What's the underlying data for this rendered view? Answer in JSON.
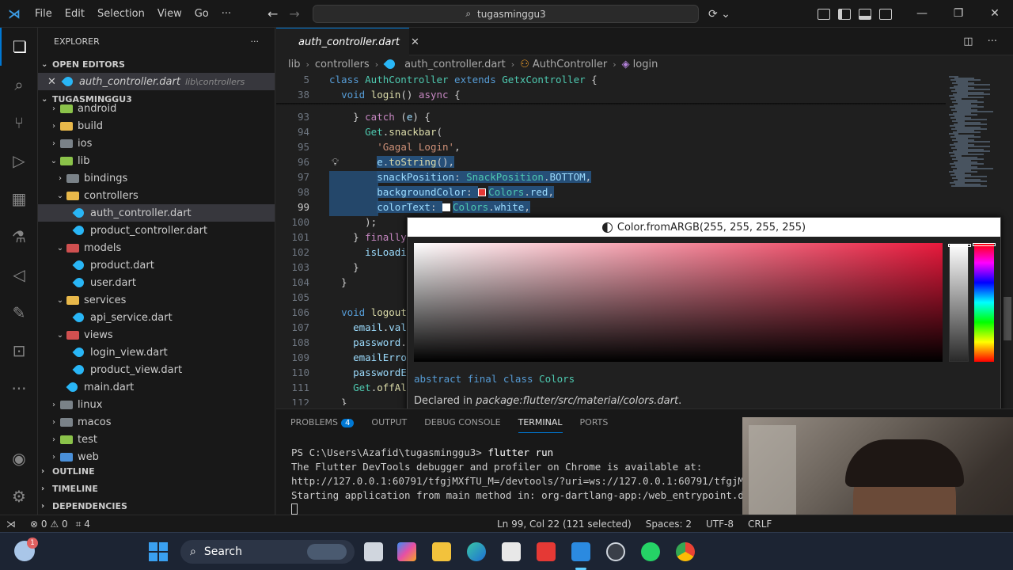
{
  "titlebar": {
    "menu": [
      "File",
      "Edit",
      "Selection",
      "View",
      "Go"
    ],
    "more": "···",
    "search": "tugasminggu3"
  },
  "sidebar": {
    "title": "EXPLORER",
    "more": "···",
    "open_editors_label": "OPEN EDITORS",
    "open_editor": {
      "name": "auth_controller.dart",
      "path": "lib\\controllers"
    },
    "project_label": "TUGASMINGGU3",
    "tree": [
      {
        "label": "android",
        "depth": 1,
        "type": "folder",
        "color": "green",
        "twisty": "›"
      },
      {
        "label": "build",
        "depth": 1,
        "type": "folder",
        "color": "yellow",
        "twisty": "›"
      },
      {
        "label": "ios",
        "depth": 1,
        "type": "folder",
        "color": "grey",
        "twisty": "›"
      },
      {
        "label": "lib",
        "depth": 1,
        "type": "folder",
        "color": "green",
        "twisty": "⌄"
      },
      {
        "label": "bindings",
        "depth": 2,
        "type": "folder",
        "color": "grey",
        "twisty": "›"
      },
      {
        "label": "controllers",
        "depth": 2,
        "type": "folder",
        "color": "yellow",
        "twisty": "⌄"
      },
      {
        "label": "auth_controller.dart",
        "depth": 3,
        "type": "dart",
        "selected": true
      },
      {
        "label": "product_controller.dart",
        "depth": 3,
        "type": "dart"
      },
      {
        "label": "models",
        "depth": 2,
        "type": "folder",
        "color": "red",
        "twisty": "⌄"
      },
      {
        "label": "product.dart",
        "depth": 3,
        "type": "dart"
      },
      {
        "label": "user.dart",
        "depth": 3,
        "type": "dart"
      },
      {
        "label": "services",
        "depth": 2,
        "type": "folder",
        "color": "yellow",
        "twisty": "⌄"
      },
      {
        "label": "api_service.dart",
        "depth": 3,
        "type": "dart"
      },
      {
        "label": "views",
        "depth": 2,
        "type": "folder",
        "color": "red",
        "twisty": "⌄"
      },
      {
        "label": "login_view.dart",
        "depth": 3,
        "type": "dart"
      },
      {
        "label": "product_view.dart",
        "depth": 3,
        "type": "dart"
      },
      {
        "label": "main.dart",
        "depth": 2,
        "type": "dart"
      },
      {
        "label": "linux",
        "depth": 1,
        "type": "folder",
        "color": "grey",
        "twisty": "›"
      },
      {
        "label": "macos",
        "depth": 1,
        "type": "folder",
        "color": "grey",
        "twisty": "›"
      },
      {
        "label": "test",
        "depth": 1,
        "type": "folder",
        "color": "green",
        "twisty": "›"
      },
      {
        "label": "web",
        "depth": 1,
        "type": "folder",
        "color": "blue",
        "twisty": "›"
      }
    ],
    "bottom_sections": [
      "OUTLINE",
      "TIMELINE",
      "DEPENDENCIES"
    ]
  },
  "editor": {
    "tab": "auth_controller.dart",
    "breadcrumb": [
      "lib",
      "controllers",
      "auth_controller.dart",
      "AuthController",
      "login"
    ]
  },
  "code": [
    {
      "n": "5",
      "sticky": true,
      "tokens": [
        [
          "kw",
          "class "
        ],
        [
          "ty",
          "AuthController "
        ],
        [
          "kw",
          "extends "
        ],
        [
          "ty",
          "GetxController "
        ],
        [
          "",
          "{"
        ]
      ]
    },
    {
      "n": "38",
      "sticky": true,
      "tokens": [
        [
          "",
          "  "
        ],
        [
          "kw",
          "void "
        ],
        [
          "fn",
          "login"
        ],
        [
          "",
          "() "
        ],
        [
          "kw2",
          "async "
        ],
        [
          "",
          "{"
        ]
      ]
    },
    {
      "n": "93",
      "tokens": [
        [
          "",
          "    } "
        ],
        [
          "kw2",
          "catch "
        ],
        [
          "",
          "("
        ],
        [
          "pm",
          "e"
        ],
        [
          "",
          ") {"
        ]
      ]
    },
    {
      "n": "94",
      "tokens": [
        [
          "",
          "      "
        ],
        [
          "ty",
          "Get"
        ],
        [
          "",
          "."
        ],
        [
          "fn",
          "snackbar"
        ],
        [
          "",
          "("
        ]
      ]
    },
    {
      "n": "95",
      "tokens": [
        [
          "",
          "        "
        ],
        [
          "st",
          "'Gagal Login'"
        ],
        [
          "",
          ","
        ]
      ]
    },
    {
      "n": "96",
      "tokens": [
        [
          "",
          "        "
        ],
        [
          "pm",
          "e"
        ],
        [
          "",
          "."
        ],
        [
          "fn",
          "toString"
        ],
        [
          "",
          "(),"
        ]
      ],
      "sel": "partial"
    },
    {
      "n": "97",
      "tokens": [
        [
          "",
          "        "
        ],
        [
          "pm",
          "snackPosition"
        ],
        [
          "",
          ": "
        ],
        [
          "ty",
          "SnackPosition"
        ],
        [
          "",
          "."
        ],
        [
          "pm",
          "BOTTOM"
        ],
        [
          "",
          ","
        ]
      ],
      "sel": "full"
    },
    {
      "n": "98",
      "tokens": [
        [
          "",
          "        "
        ],
        [
          "pm",
          "backgroundColor"
        ],
        [
          "",
          ": "
        ],
        [
          "swatch",
          "#e53935"
        ],
        [
          "ty",
          "Colors"
        ],
        [
          "",
          "."
        ],
        [
          "pm",
          "red"
        ],
        [
          "",
          ","
        ]
      ],
      "sel": "full"
    },
    {
      "n": "99",
      "tokens": [
        [
          "",
          "        "
        ],
        [
          "pm",
          "colorText"
        ],
        [
          "",
          ": "
        ],
        [
          "swatch",
          "#ffffff"
        ],
        [
          "ty",
          "Colors"
        ],
        [
          "",
          "."
        ],
        [
          "pm",
          "white"
        ],
        [
          "",
          ","
        ]
      ],
      "sel": "full",
      "current": true
    },
    {
      "n": "100",
      "tokens": [
        [
          "",
          "      );"
        ]
      ]
    },
    {
      "n": "101",
      "tokens": [
        [
          "",
          "    } "
        ],
        [
          "kw2",
          "finally"
        ]
      ]
    },
    {
      "n": "102",
      "tokens": [
        [
          "",
          "      "
        ],
        [
          "pm",
          "isLoadi"
        ]
      ]
    },
    {
      "n": "103",
      "tokens": [
        [
          "",
          "    }"
        ]
      ]
    },
    {
      "n": "104",
      "tokens": [
        [
          "",
          "  }"
        ]
      ]
    },
    {
      "n": "105",
      "tokens": []
    },
    {
      "n": "106",
      "tokens": [
        [
          "",
          "  "
        ],
        [
          "kw",
          "void "
        ],
        [
          "fn",
          "logout"
        ]
      ]
    },
    {
      "n": "107",
      "tokens": [
        [
          "",
          "    "
        ],
        [
          "pm",
          "email"
        ],
        [
          "",
          "."
        ],
        [
          "pm",
          "val"
        ]
      ]
    },
    {
      "n": "108",
      "tokens": [
        [
          "",
          "    "
        ],
        [
          "pm",
          "password"
        ],
        [
          "",
          "."
        ]
      ]
    },
    {
      "n": "109",
      "tokens": [
        [
          "",
          "    "
        ],
        [
          "pm",
          "emailErro"
        ]
      ]
    },
    {
      "n": "110",
      "tokens": [
        [
          "",
          "    "
        ],
        [
          "pm",
          "passwordE"
        ]
      ]
    },
    {
      "n": "111",
      "tokens": [
        [
          "",
          "    "
        ],
        [
          "ty",
          "Get"
        ],
        [
          "",
          "."
        ],
        [
          "fn",
          "offAl"
        ]
      ]
    },
    {
      "n": "112",
      "tokens": [
        [
          "",
          "  }"
        ]
      ]
    }
  ],
  "hover": {
    "color_label": "Color.fromARGB(255, 255, 255, 255)",
    "picker_hue_color": "#e8193c",
    "decl_kw": "abstract final class ",
    "decl_name": "Colors",
    "declared_prefix": "Declared in ",
    "declared_path": "package:flutter/src/material/colors.dart",
    "declared_suffix": "."
  },
  "panel": {
    "tabs": [
      "PROBLEMS",
      "OUTPUT",
      "DEBUG CONSOLE",
      "TERMINAL",
      "PORTS"
    ],
    "problems_count": "4",
    "active_tab": "TERMINAL",
    "terminal": {
      "prompt": "PS C:\\Users\\Azafid\\tugasminggu3> ",
      "command": "flutter run",
      "lines": [
        "The Flutter DevTools debugger and profiler on Chrome is available at:",
        "http://127.0.0.1:60791/tfgjMXfTU_M=/devtools/?uri=ws://127.0.0.1:60791/tfgjMXf",
        "Starting application from main method in: org-dartlang-app:/web_entrypoint.dar"
      ]
    }
  },
  "statusbar": {
    "errors": "0",
    "warnings": "0",
    "ports": "4",
    "position": "Ln 99, Col 22 (121 selected)",
    "spaces": "Spaces: 2",
    "encoding": "UTF-8",
    "eol": "CRLF"
  },
  "taskbar": {
    "search": "Search",
    "notification_count": "1"
  }
}
